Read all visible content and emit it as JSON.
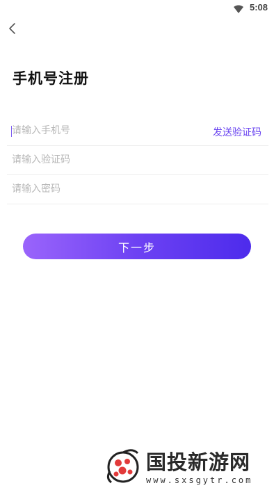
{
  "status_bar": {
    "time": "5:08",
    "wifi_icon": "wifi-icon"
  },
  "header": {
    "back_icon": "chevron-left-icon",
    "title": "手机号注册"
  },
  "form": {
    "phone": {
      "placeholder": "请输入手机号",
      "value": ""
    },
    "send_code_label": "发送验证码",
    "code": {
      "placeholder": "请输入验证码",
      "value": ""
    },
    "password": {
      "placeholder": "请输入密码",
      "value": ""
    }
  },
  "next_button_label": "下一步",
  "watermark": {
    "title": "国投新游网",
    "url": "www.sxsgytr.com"
  },
  "colors": {
    "accent": "#6a45f0",
    "gradient_start": "#9a64fb",
    "gradient_end": "#4d2bec"
  }
}
